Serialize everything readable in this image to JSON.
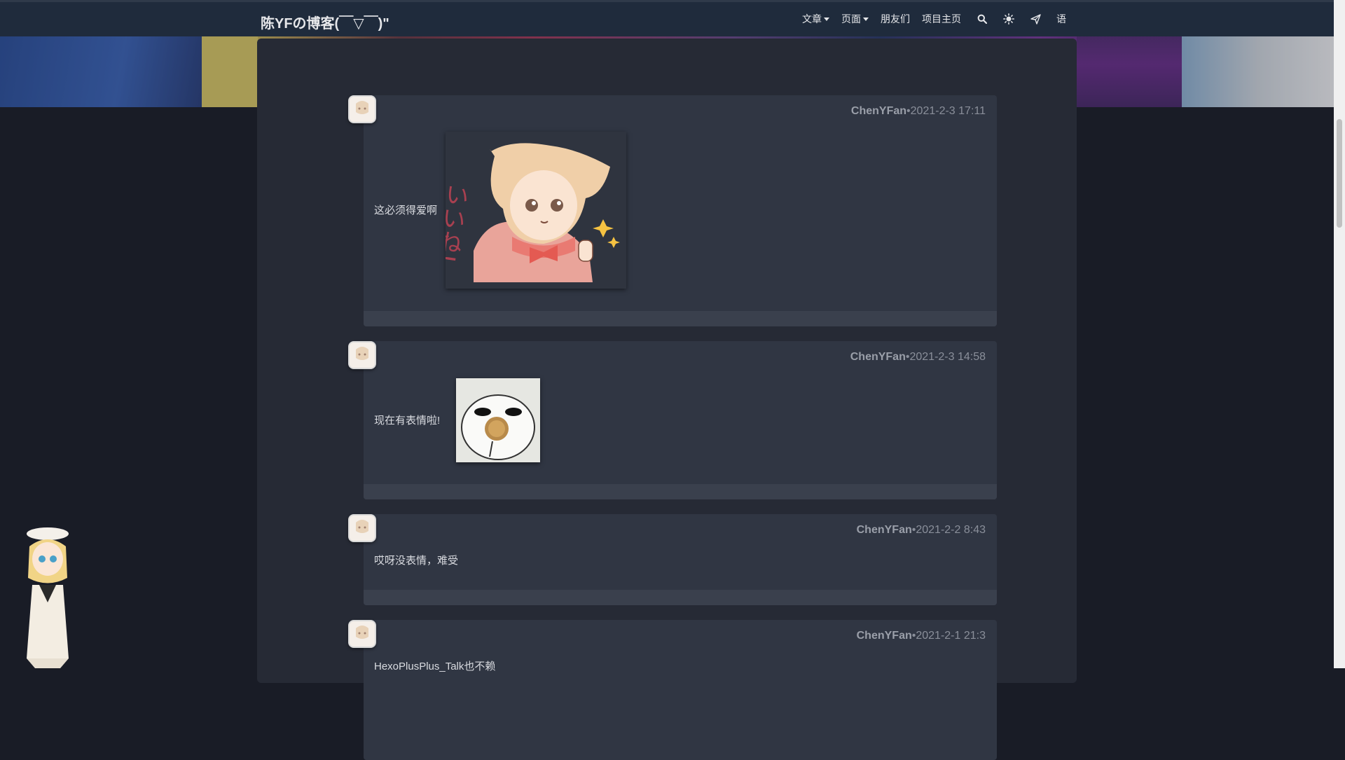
{
  "site": {
    "brand": "陈YFの博客(￣▽￣)\"",
    "nav": [
      {
        "label": "文章",
        "dropdown": true
      },
      {
        "label": "页面",
        "dropdown": true
      },
      {
        "label": "朋友们",
        "dropdown": false
      },
      {
        "label": "项目主页",
        "dropdown": false
      }
    ],
    "icons": [
      "search-icon",
      "theme-toggle-icon",
      "send-icon"
    ],
    "lang_label": "语"
  },
  "comments": [
    {
      "author": "ChenYFan",
      "sep": "•",
      "time": "2021-2-3 17:11",
      "text": "这必须得爱啊",
      "sticker": "iine-girl-sticker"
    },
    {
      "author": "ChenYFan",
      "sep": "•",
      "time": "2021-2-3 14:58",
      "text": "现在有表情啦!",
      "sticker": "ghost-eating-sticker"
    },
    {
      "author": "ChenYFan",
      "sep": "•",
      "time": "2021-2-2 8:43",
      "text": "哎呀没表情，难受"
    },
    {
      "author": "ChenYFan",
      "sep": "•",
      "time": "2021-2-1 21:3",
      "text": "HexoPlusPlus_Talk也不赖"
    }
  ],
  "sticker_text": "いいね!"
}
